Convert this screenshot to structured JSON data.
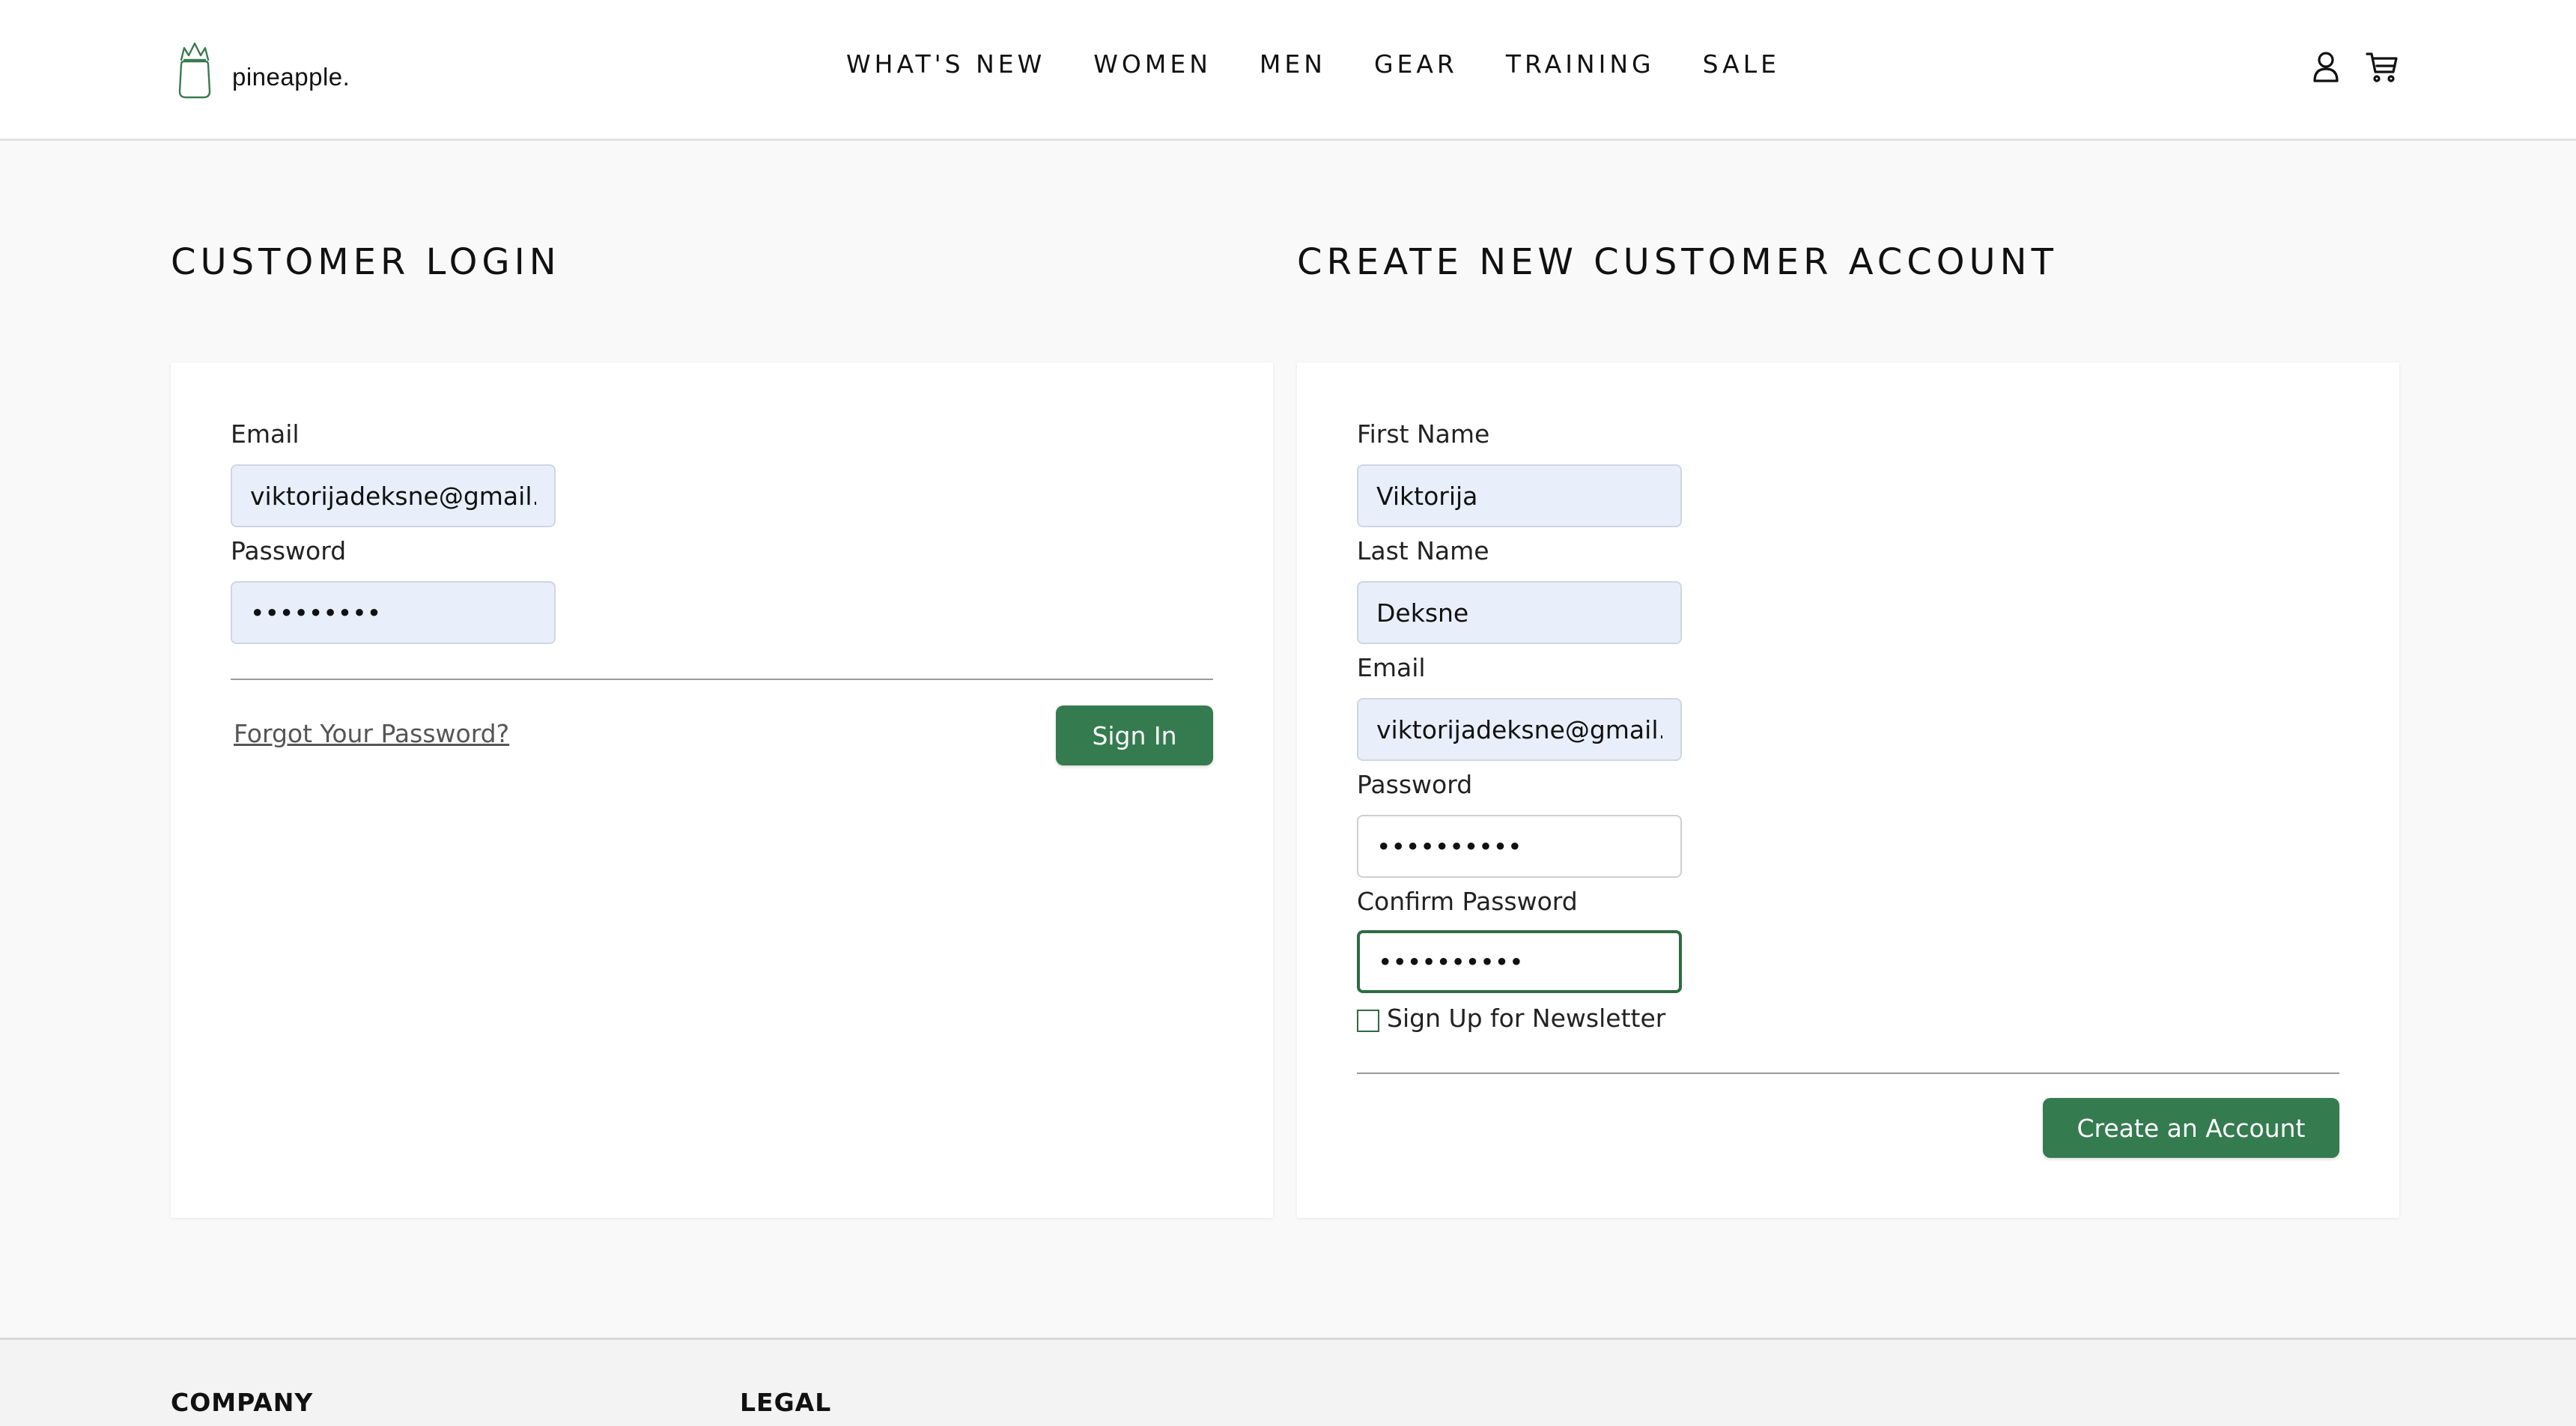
{
  "brand": {
    "name": "pineapple."
  },
  "nav": {
    "items": [
      "WHAT'S NEW",
      "WOMEN",
      "MEN",
      "GEAR",
      "TRAINING",
      "SALE"
    ]
  },
  "header_icons": [
    "user-icon",
    "cart-icon"
  ],
  "login": {
    "title": "CUSTOMER LOGIN",
    "email_label": "Email",
    "email_value": "viktorijadeksne@gmail.com",
    "password_label": "Password",
    "password_value": "•••••••••",
    "forgot_link": "Forgot Your Password?",
    "sign_in_button": "Sign In"
  },
  "register": {
    "title": "CREATE NEW CUSTOMER ACCOUNT",
    "first_name_label": "First Name",
    "first_name_value": "Viktorija",
    "last_name_label": "Last Name",
    "last_name_value": "Deksne",
    "email_label": "Email",
    "email_value": "viktorijadeksne@gmail.com",
    "password_label": "Password",
    "password_value": "••••••••••",
    "confirm_password_label": "Confirm Password",
    "confirm_password_value": "••••••••••",
    "newsletter_label": "Sign Up for Newsletter",
    "newsletter_checked": false,
    "create_button": "Create an Account"
  },
  "footer": {
    "headings": [
      "COMPANY",
      "LEGAL"
    ]
  },
  "colors": {
    "accent": "#357b50",
    "autofill_bg": "#e8effb",
    "page_bg": "#f9f9f9"
  }
}
